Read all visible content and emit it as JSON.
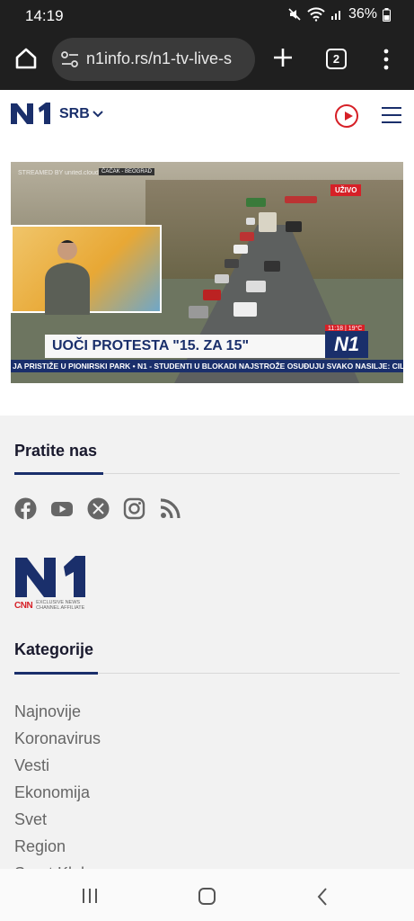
{
  "status_bar": {
    "time": "14:19",
    "battery": "36%"
  },
  "browser": {
    "url": "n1info.rs/n1-tv-live-s",
    "tab_count": "2",
    "icons": [
      "home-icon",
      "site-info-icon",
      "new-tab-icon",
      "tab-switcher-icon",
      "more-menu-icon"
    ]
  },
  "site_header": {
    "logo": "N1",
    "region": "SRB",
    "icons": [
      "play-live-icon",
      "hamburger-menu-icon"
    ],
    "accent_color": "#1a2f6b",
    "live_color": "#d62027"
  },
  "video": {
    "stream_label": "STREAMED BY united.cloud",
    "city_tag": "ČAČAK - BEOGRAD",
    "live_badge": "UŽIVO",
    "headline": "UOČI PROTESTA \"15. ZA 15\"",
    "channel_logo": "N1",
    "clock": "11:18 | 19°C",
    "ticker": "JA PRISTIŽE U PIONIRSKI PARK • N1 - STUDENTI U BLOKADI NAJSTROŽE OSUĐUJU SVAKO NASILJE: CILJ"
  },
  "follow": {
    "title": "Pratite nas",
    "icons": [
      "facebook-icon",
      "youtube-icon",
      "x-icon",
      "instagram-icon",
      "rss-icon"
    ]
  },
  "brand": {
    "logo": "N1",
    "cnn": "CNN",
    "affiliate_line1": "EXCLUSIVE NEWS",
    "affiliate_line2": "CHANNEL AFFILIATE"
  },
  "categories": {
    "title": "Kategorije",
    "items": [
      "Najnovije",
      "Koronavirus",
      "Vesti",
      "Ekonomija",
      "Svet",
      "Region",
      "Sport Klub"
    ]
  },
  "nav_bar": {
    "icons": [
      "recent-apps-icon",
      "home-button-icon",
      "back-icon"
    ]
  }
}
